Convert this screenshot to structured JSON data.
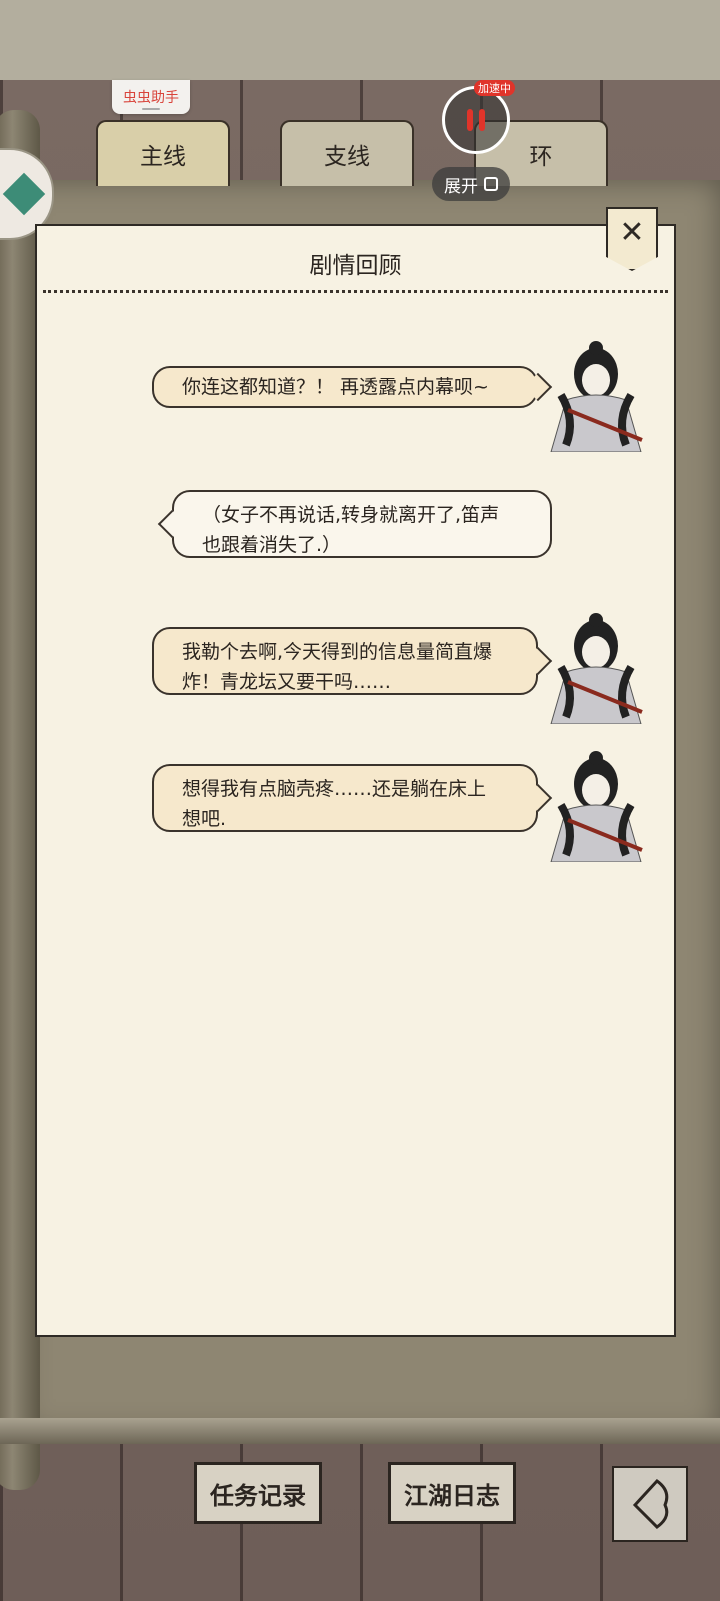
{
  "helper": {
    "label": "虫虫助手"
  },
  "tabs": [
    {
      "label": "主线",
      "active": true
    },
    {
      "label": "支线",
      "active": false
    },
    {
      "label": "环",
      "active": false
    }
  ],
  "overlay": {
    "speed_badge": "加速中",
    "expand_label": "展开"
  },
  "panel": {
    "title": "剧情回顾"
  },
  "dialogue": [
    {
      "side": "right",
      "text_lines": [
        "你连这都知道？！ 再透露点内幕呗~"
      ]
    },
    {
      "side": "left",
      "text_lines": [
        "（女子不再说话,转身就离开了,笛声",
        "也跟着消失了.）"
      ]
    },
    {
      "side": "right",
      "text_lines": [
        "我勒个去啊,今天得到的信息量简直爆",
        "炸！青龙坛又要干吗……"
      ]
    },
    {
      "side": "right",
      "text_lines": [
        "想得我有点脑壳疼……还是躺在床上",
        "想吧."
      ]
    }
  ],
  "bottom": {
    "task_log": "任务记录",
    "jianghu_log": "江湖日志"
  },
  "icons": {
    "close": "close-icon",
    "back": "back-arrow-icon",
    "pause": "pause-icon",
    "expand": "expand-icon",
    "app": "app-icon"
  },
  "colors": {
    "panel_bg": "#f7f2e3",
    "bubble_right": "#f6e8cc",
    "bubble_left": "#faf6ec",
    "accent_red": "#e0342a"
  }
}
